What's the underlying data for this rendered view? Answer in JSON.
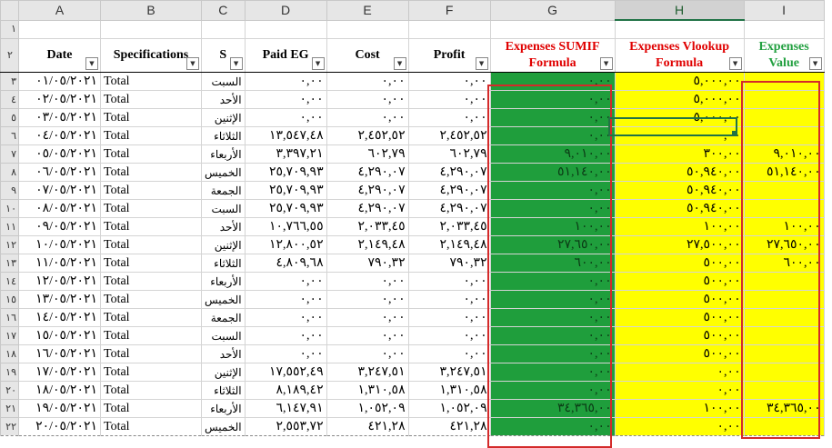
{
  "columns": [
    "A",
    "B",
    "C",
    "D",
    "E",
    "F",
    "G",
    "H",
    "I"
  ],
  "headers": {
    "A": "Date",
    "B": "Specifications",
    "C": "S",
    "D": "Paid EG",
    "E": "Cost",
    "F": "Profit",
    "G": "Expenses SUMIF Formula",
    "H": "Expenses Vlookup Formula",
    "I": "Expenses Value"
  },
  "header_row_number": "٢",
  "blank_row_number": "١",
  "colors": {
    "green_fill": "#1f9e3c",
    "yellow_fill": "#ffff00",
    "red_text": "#e00000",
    "green_text": "#22a040",
    "box": "#d42a2a"
  },
  "rows": [
    {
      "n": "٣",
      "date": "٠١/٠٥/٢٠٢١",
      "spec": "Total",
      "day": "السبت",
      "paid": "٠,٠٠",
      "cost": "٠,٠٠",
      "profit": "٠,٠٠",
      "g": "٠,٠٠",
      "h": "٥,٠٠٠,٠٠",
      "i": ""
    },
    {
      "n": "٤",
      "date": "٠٢/٠٥/٢٠٢١",
      "spec": "Total",
      "day": "الأحد",
      "paid": "٠,٠٠",
      "cost": "٠,٠٠",
      "profit": "٠,٠٠",
      "g": "٠,٠٠",
      "h": "٥,٠٠٠,٠٠",
      "i": ""
    },
    {
      "n": "٥",
      "date": "٠٣/٠٥/٢٠٢١",
      "spec": "Total",
      "day": "الإثنين",
      "paid": "٠,٠٠",
      "cost": "٠,٠٠",
      "profit": "٠,٠٠",
      "g": "٠,٠٠",
      "h": "٥,٠٠٠,٠٠",
      "i": ""
    },
    {
      "n": "٦",
      "date": "٠٤/٠٥/٢٠٢١",
      "spec": "Total",
      "day": "الثلاثاء",
      "paid": "١٣,٥٤٧,٤٨",
      "cost": "٢,٤٥٢,٥٢",
      "profit": "٢,٤٥٢,٥٢",
      "g": "٠,٠٠",
      "h": "٠,٠٠",
      "i": ""
    },
    {
      "n": "٧",
      "date": "٠٥/٠٥/٢٠٢١",
      "spec": "Total",
      "day": "الأربعاء",
      "paid": "٣,٣٩٧,٢١",
      "cost": "٦٠٢,٧٩",
      "profit": "٦٠٢,٧٩",
      "g": "٩,٠١٠,٠٠",
      "h": "٣٠٠,٠٠",
      "i": "٩,٠١٠,٠٠"
    },
    {
      "n": "٨",
      "date": "٠٦/٠٥/٢٠٢١",
      "spec": "Total",
      "day": "الخميس",
      "paid": "٢٥,٧٠٩,٩٣",
      "cost": "٤,٢٩٠,٠٧",
      "profit": "٤,٢٩٠,٠٧",
      "g": "٥١,١٤٠,٠٠",
      "h": "٥٠,٩٤٠,٠٠",
      "i": "٥١,١٤٠,٠٠"
    },
    {
      "n": "٩",
      "date": "٠٧/٠٥/٢٠٢١",
      "spec": "Total",
      "day": "الجمعة",
      "paid": "٢٥,٧٠٩,٩٣",
      "cost": "٤,٢٩٠,٠٧",
      "profit": "٤,٢٩٠,٠٧",
      "g": "٠,٠٠",
      "h": "٥٠,٩٤٠,٠٠",
      "i": ""
    },
    {
      "n": "١٠",
      "date": "٠٨/٠٥/٢٠٢١",
      "spec": "Total",
      "day": "السبت",
      "paid": "٢٥,٧٠٩,٩٣",
      "cost": "٤,٢٩٠,٠٧",
      "profit": "٤,٢٩٠,٠٧",
      "g": "٠,٠٠",
      "h": "٥٠,٩٤٠,٠٠",
      "i": ""
    },
    {
      "n": "١١",
      "date": "٠٩/٠٥/٢٠٢١",
      "spec": "Total",
      "day": "الأحد",
      "paid": "١٠,٧٦٦,٥٥",
      "cost": "٢,٠٣٣,٤٥",
      "profit": "٢,٠٣٣,٤٥",
      "g": "١٠٠,٠٠",
      "h": "١٠٠,٠٠",
      "i": "١٠٠,٠٠"
    },
    {
      "n": "١٢",
      "date": "١٠/٠٥/٢٠٢١",
      "spec": "Total",
      "day": "الإثنين",
      "paid": "١٢,٨٠٠,٥٢",
      "cost": "٢,١٤٩,٤٨",
      "profit": "٢,١٤٩,٤٨",
      "g": "٢٧,٦٥٠,٠٠",
      "h": "٢٧,٥٠٠,٠٠",
      "i": "٢٧,٦٥٠,٠٠"
    },
    {
      "n": "١٣",
      "date": "١١/٠٥/٢٠٢١",
      "spec": "Total",
      "day": "الثلاثاء",
      "paid": "٤,٨٠٩,٦٨",
      "cost": "٧٩٠,٣٢",
      "profit": "٧٩٠,٣٢",
      "g": "٦٠٠,٠٠",
      "h": "٥٠٠,٠٠",
      "i": "٦٠٠,٠٠"
    },
    {
      "n": "١٤",
      "date": "١٢/٠٥/٢٠٢١",
      "spec": "Total",
      "day": "الأربعاء",
      "paid": "٠,٠٠",
      "cost": "٠,٠٠",
      "profit": "٠,٠٠",
      "g": "٠,٠٠",
      "h": "٥٠٠,٠٠",
      "i": ""
    },
    {
      "n": "١٥",
      "date": "١٣/٠٥/٢٠٢١",
      "spec": "Total",
      "day": "الخميس",
      "paid": "٠,٠٠",
      "cost": "٠,٠٠",
      "profit": "٠,٠٠",
      "g": "٠,٠٠",
      "h": "٥٠٠,٠٠",
      "i": ""
    },
    {
      "n": "١٦",
      "date": "١٤/٠٥/٢٠٢١",
      "spec": "Total",
      "day": "الجمعة",
      "paid": "٠,٠٠",
      "cost": "٠,٠٠",
      "profit": "٠,٠٠",
      "g": "٠,٠٠",
      "h": "٥٠٠,٠٠",
      "i": ""
    },
    {
      "n": "١٧",
      "date": "١٥/٠٥/٢٠٢١",
      "spec": "Total",
      "day": "السبت",
      "paid": "٠,٠٠",
      "cost": "٠,٠٠",
      "profit": "٠,٠٠",
      "g": "٠,٠٠",
      "h": "٥٠٠,٠٠",
      "i": ""
    },
    {
      "n": "١٨",
      "date": "١٦/٠٥/٢٠٢١",
      "spec": "Total",
      "day": "الأحد",
      "paid": "٠,٠٠",
      "cost": "٠,٠٠",
      "profit": "٠,٠٠",
      "g": "٠,٠٠",
      "h": "٥٠٠,٠٠",
      "i": ""
    },
    {
      "n": "١٩",
      "date": "١٧/٠٥/٢٠٢١",
      "spec": "Total",
      "day": "الإثنين",
      "paid": "١٧,٥٥٢,٤٩",
      "cost": "٣,٢٤٧,٥١",
      "profit": "٣,٢٤٧,٥١",
      "g": "٠,٠٠",
      "h": "٠,٠٠",
      "i": ""
    },
    {
      "n": "٢٠",
      "date": "١٨/٠٥/٢٠٢١",
      "spec": "Total",
      "day": "الثلاثاء",
      "paid": "٨,١٨٩,٤٢",
      "cost": "١,٣١٠,٥٨",
      "profit": "١,٣١٠,٥٨",
      "g": "٠,٠٠",
      "h": "٠,٠٠",
      "i": ""
    },
    {
      "n": "٢١",
      "date": "١٩/٠٥/٢٠٢١",
      "spec": "Total",
      "day": "الأربعاء",
      "paid": "٦,١٤٧,٩١",
      "cost": "١,٠٥٢,٠٩",
      "profit": "١,٠٥٢,٠٩",
      "g": "٣٤,٣٦٥,٠٠",
      "h": "١٠٠,٠٠",
      "i": "٣٤,٣٦٥,٠٠"
    },
    {
      "n": "٢٢",
      "date": "٢٠/٠٥/٢٠٢١",
      "spec": "Total",
      "day": "الخميس",
      "paid": "٢,٥٥٣,٧٢",
      "cost": "٤٢١,٢٨",
      "profit": "٤٢١,٢٨",
      "g": "٠,٠٠",
      "h": "٠,٠٠",
      "i": ""
    }
  ]
}
